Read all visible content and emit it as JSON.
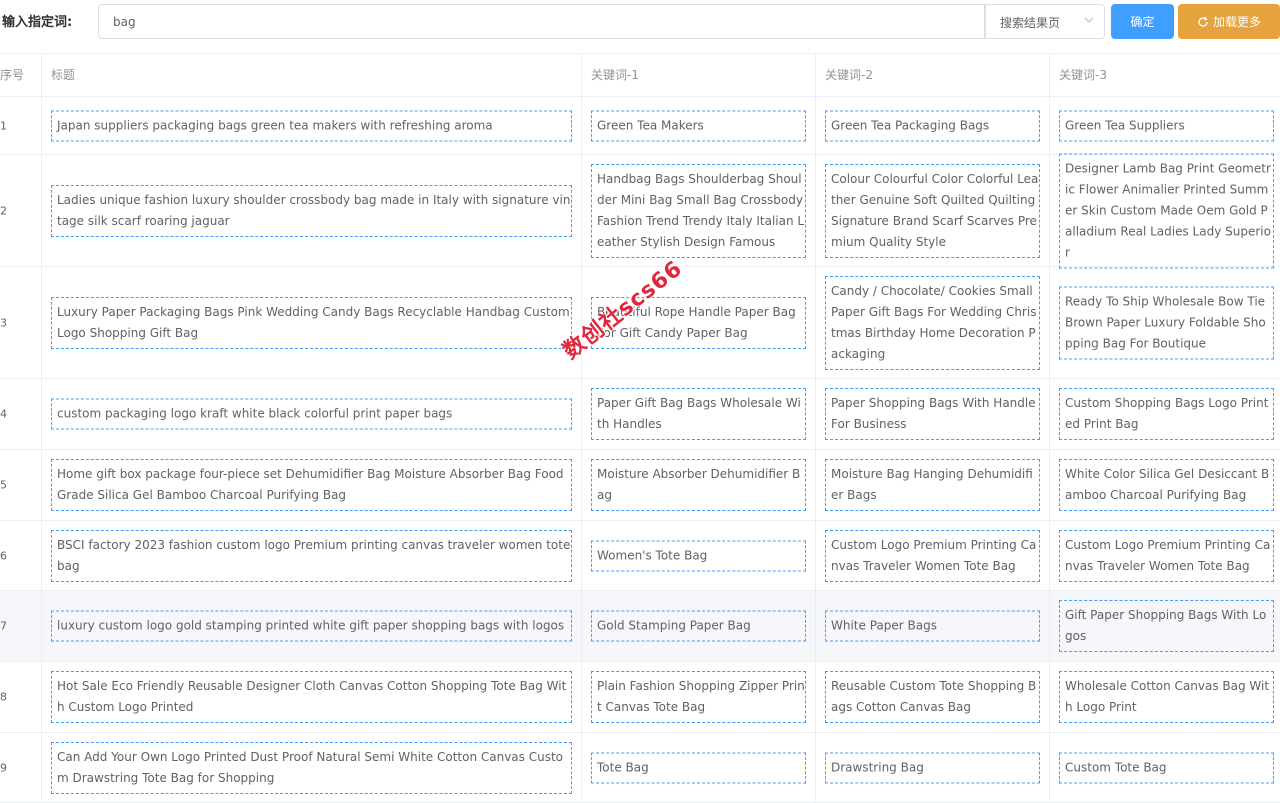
{
  "toolbar": {
    "label": "输入指定词:",
    "search_value": "bag",
    "select_value": "搜索结果页",
    "ok_label": "确定",
    "more_label": "加载更多"
  },
  "colors": {
    "primary": "#409eff",
    "warning": "#e6a23c"
  },
  "table": {
    "headers": [
      "序号",
      "标题",
      "关键词-1",
      "关键词-2",
      "关键词-3"
    ],
    "rows": [
      {
        "no": "1",
        "title": "Japan suppliers packaging bags green tea makers with refreshing aroma",
        "k1": "Green Tea Makers",
        "k2": "Green Tea Packaging Bags",
        "k3": "Green Tea Suppliers"
      },
      {
        "no": "2",
        "title": "Ladies unique fashion luxury shoulder crossbody bag made in Italy with signature vintage silk scarf roaring jaguar",
        "k1": "Handbag Bags Shoulderbag Shoulder Mini Bag Small Bag Crossbody Fashion Trend Trendy Italy Italian Leather Stylish Design Famous",
        "k2": "Colour Colourful Color Colorful Leather Genuine Soft Quilted Quilting Signature Brand Scarf Scarves Premium Quality Style",
        "k3": "Designer Lamb Bag Print Geometric Flower Animalier Printed Summer Skin Custom Made Oem Gold Palladium Real Ladies Lady Superior"
      },
      {
        "no": "3",
        "title": "Luxury Paper Packaging Bags Pink Wedding Candy Bags Recyclable Handbag Custom Logo Shopping Gift Bag",
        "k1": "Beautiful Rope Handle Paper Bag For Gift Candy Paper Bag",
        "k2": "Candy / Chocolate/ Cookies Small Paper Gift Bags For Wedding Christmas Birthday Home Decoration Packaging",
        "k3": "Ready To Ship Wholesale Bow Tie Brown Paper Luxury Foldable Shopping Bag For Boutique"
      },
      {
        "no": "4",
        "title": "custom packaging logo kraft white black colorful print paper bags",
        "k1": "Paper Gift Bag Bags Wholesale With Handles",
        "k2": "Paper Shopping Bags With Handle For Business",
        "k3": "Custom Shopping Bags Logo Printed Print Bag"
      },
      {
        "no": "5",
        "title": "Home gift box package four-piece set Dehumidifier Bag Moisture Absorber Bag Food Grade Silica Gel Bamboo Charcoal Purifying Bag",
        "k1": "Moisture Absorber Dehumidifier Bag",
        "k2": "Moisture Bag Hanging Dehumidifier Bags",
        "k3": "White Color Silica Gel Desiccant Bamboo Charcoal Purifying Bag"
      },
      {
        "no": "6",
        "title": "BSCI factory 2023 fashion custom logo Premium printing canvas traveler women tote bag",
        "k1": "Women's Tote Bag",
        "k2": "Custom Logo Premium Printing Canvas Traveler Women Tote Bag",
        "k3": "Custom Logo Premium Printing Canvas Traveler Women Tote Bag"
      },
      {
        "no": "7",
        "title": "luxury custom logo gold stamping printed white gift paper shopping bags with logos",
        "k1": "Gold Stamping Paper Bag",
        "k2": "White Paper Bags",
        "k3": "Gift Paper Shopping Bags With Logos"
      },
      {
        "no": "8",
        "title": "Hot Sale Eco Friendly Reusable Designer Cloth Canvas Cotton Shopping Tote Bag With Custom Logo Printed",
        "k1": "Plain Fashion Shopping Zipper Print Canvas Tote Bag",
        "k2": "Reusable Custom Tote Shopping Bags Cotton Canvas Bag",
        "k3": "Wholesale Cotton Canvas Bag With Logo Print"
      },
      {
        "no": "9",
        "title": "Can Add Your Own Logo Printed Dust Proof Natural Semi White Cotton Canvas Custom Drawstring Tote Bag for Shopping",
        "k1": "Tote Bag",
        "k2": "Drawstring Bag",
        "k3": "Custom Tote Bag"
      }
    ]
  },
  "watermark": "数创社scs66"
}
